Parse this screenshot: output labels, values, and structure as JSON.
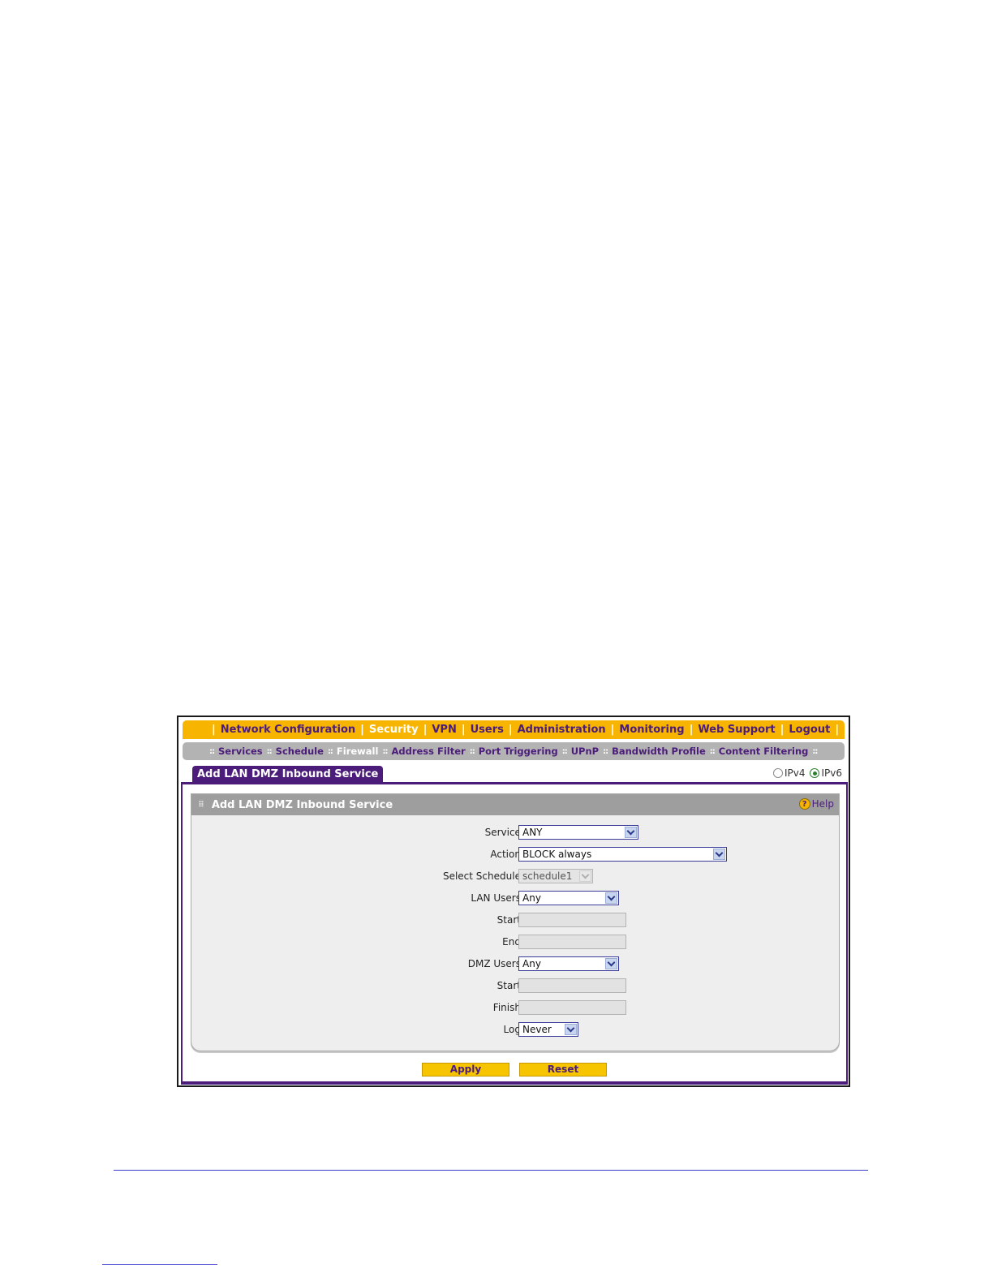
{
  "topnav": {
    "items": [
      {
        "label": "Network Configuration"
      },
      {
        "label": "Security"
      },
      {
        "label": "VPN"
      },
      {
        "label": "Users"
      },
      {
        "label": "Administration"
      },
      {
        "label": "Monitoring"
      },
      {
        "label": "Web Support"
      },
      {
        "label": "Logout"
      }
    ]
  },
  "subnav": {
    "items": [
      {
        "label": "Services"
      },
      {
        "label": "Schedule"
      },
      {
        "label": "Firewall"
      },
      {
        "label": "Address Filter"
      },
      {
        "label": "Port Triggering"
      },
      {
        "label": "UPnP"
      },
      {
        "label": "Bandwidth Profile"
      },
      {
        "label": "Content Filtering"
      }
    ]
  },
  "tab": {
    "label": "Add LAN DMZ Inbound Service"
  },
  "ipversion": {
    "ipv4": "IPv4",
    "ipv6": "IPv6",
    "selected": "IPv6"
  },
  "panel": {
    "title": "Add LAN DMZ Inbound Service",
    "help": "Help",
    "fields": {
      "service": {
        "label": "Service:",
        "value": "ANY"
      },
      "action": {
        "label": "Action:",
        "value": "BLOCK always"
      },
      "schedule": {
        "label": "Select Schedule:",
        "value": "schedule1"
      },
      "lan_users": {
        "label": "LAN Users:",
        "value": "Any"
      },
      "lan_start": {
        "label": "Start:"
      },
      "lan_end": {
        "label": "End:"
      },
      "dmz_users": {
        "label": "DMZ Users:",
        "value": "Any"
      },
      "dmz_start": {
        "label": "Start:"
      },
      "dmz_finish": {
        "label": "Finish:"
      },
      "log": {
        "label": "Log:",
        "value": "Never"
      }
    }
  },
  "buttons": {
    "apply": "Apply",
    "reset": "Reset"
  },
  "colors": {
    "accent_orange": "#f7b400",
    "brand_purple": "#4b1c7a",
    "panel_gray": "#9e9e9e"
  }
}
